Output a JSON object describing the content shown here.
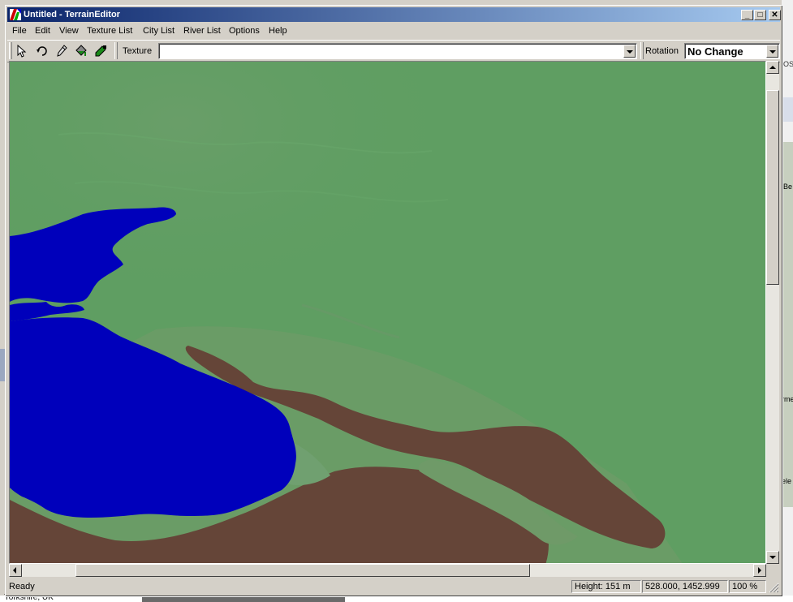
{
  "window": {
    "title": "Untitled - TerrainEditor",
    "buttons": {
      "minimize": "_",
      "maximize": "□",
      "close": "✕"
    }
  },
  "menu": [
    "File",
    "Edit",
    "View",
    "Texture List",
    "City List",
    "River List",
    "Options",
    "Help"
  ],
  "toolbar": {
    "tools": [
      "select-arrow-icon",
      "rotate-icon",
      "pencil-icon",
      "paint-bucket-icon",
      "eyedropper-icon"
    ],
    "texture_label": "Texture",
    "texture_value": "",
    "rotation_label": "Rotation",
    "rotation_value": "No Change"
  },
  "status": {
    "ready": "Ready",
    "height": "Height: 151 m",
    "coords": "528.000, 1452.999",
    "zoom": "100 %"
  },
  "background": {
    "bottom_text": "Yorkshire, UK",
    "right_text_1": "Be",
    "right_text_2": "rme",
    "right_text_3": "ele",
    "right_text_0": "OS"
  },
  "colors": {
    "land": "#5f9e62",
    "mountain": "#654538",
    "water": "#0000bb",
    "title_start": "#0a246a",
    "title_end": "#a6caf0"
  }
}
